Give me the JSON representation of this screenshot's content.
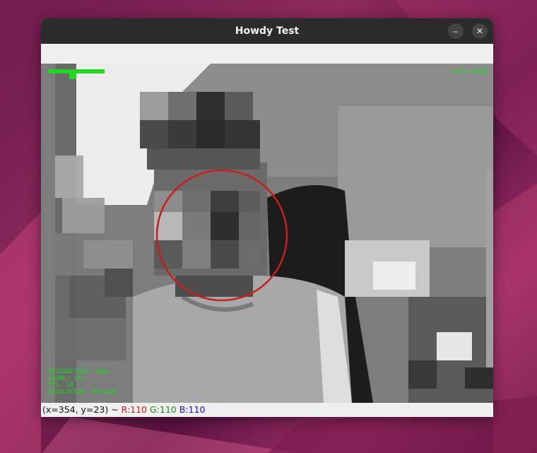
{
  "window": {
    "title": "Howdy Test",
    "minimize_glyph": "–",
    "close_glyph": "✕"
  },
  "overlay": {
    "scan_label": "SCAN FRAME",
    "recognition": "RECOGNITION: 60ms",
    "frame": "FRAME: 193",
    "fps": "FPS: 10",
    "resolution": "RESOLUTION: 480x640",
    "face_circle_color": "#c81e1e",
    "hud_color": "#22d622"
  },
  "status": {
    "coords": "(x=354, y=23) ~ ",
    "r": "R:110",
    "g": "G:110",
    "b": "B:110"
  },
  "colors": {
    "r": "#e01010",
    "g": "#168a16",
    "b": "#1010d0"
  }
}
